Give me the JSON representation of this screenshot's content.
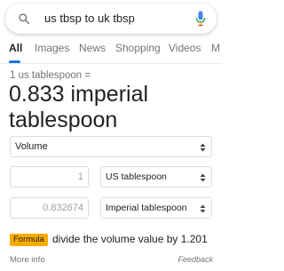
{
  "search": {
    "query": "us tbsp to uk tbsp"
  },
  "tabs": [
    {
      "label": "All",
      "active": true
    },
    {
      "label": "Images"
    },
    {
      "label": "News"
    },
    {
      "label": "Shopping"
    },
    {
      "label": "Videos"
    },
    {
      "label": "M"
    }
  ],
  "result": {
    "label": "1 us tablespoon =",
    "value": "0.833 imperial tablespoon"
  },
  "converter": {
    "category": "Volume",
    "from": {
      "value": "1",
      "unit": "US tablespoon"
    },
    "to": {
      "value": "0.832674",
      "unit": "Imperial tablespoon"
    }
  },
  "formula": {
    "badge": "Formula",
    "text": "divide the volume value by 1.201"
  },
  "footer": {
    "more_info": "More info",
    "feedback": "Feedback"
  },
  "colors": {
    "accent": "#1a73e8",
    "formula_badge": "#f9ab00"
  }
}
